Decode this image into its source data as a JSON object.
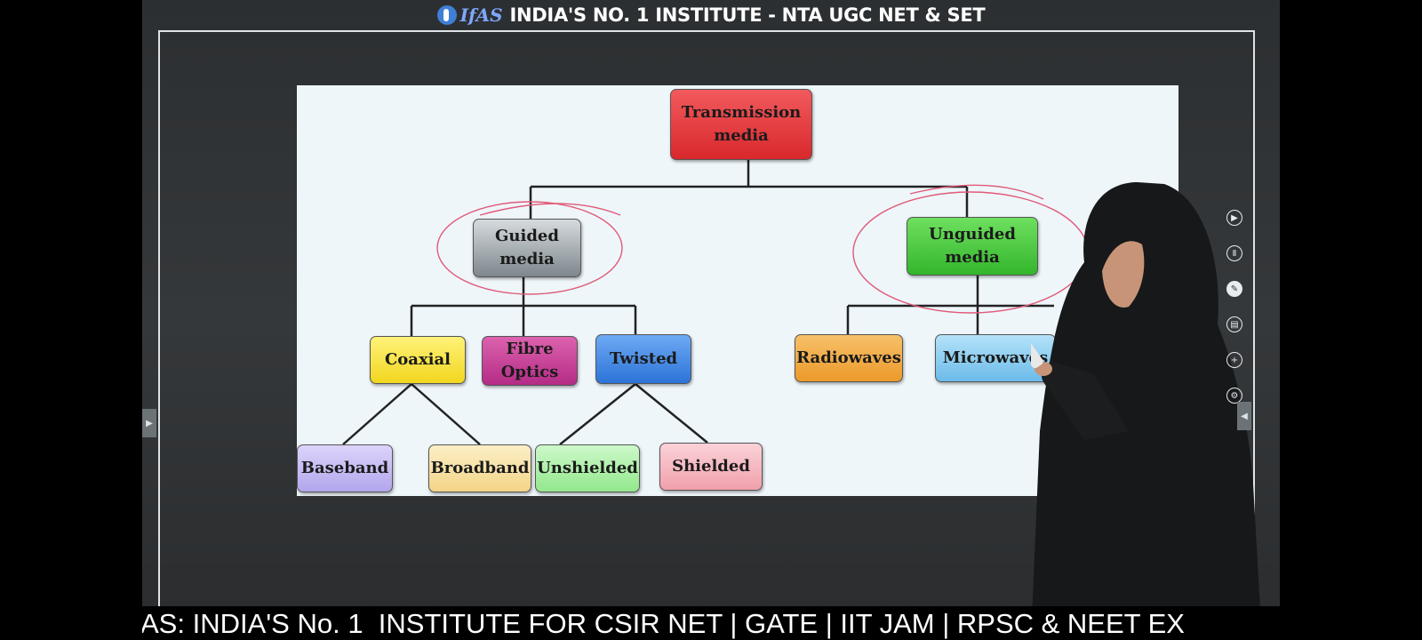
{
  "header": {
    "logo_text": "IfAS",
    "title": "INDIA'S NO. 1 INSTITUTE - NTA UGC NET & SET"
  },
  "diagram": {
    "root": "Transmission media",
    "guided": "Guided media",
    "unguided": "Unguided media",
    "coaxial": "Coaxial",
    "fibre_optics": "Fibre Optics",
    "twisted": "Twisted",
    "radiowaves": "Radiowaves",
    "microwaves": "Microwaves",
    "baseband": "Baseband",
    "broadband": "Broadband",
    "unshielded": "Unshielded",
    "shielded": "Shielded"
  },
  "colors": {
    "root": "#e0383c",
    "guided": "#9aa2a8",
    "unguided": "#47c940",
    "coaxial": "#f5e13a",
    "fibre_optics": "#c43a94",
    "twisted": "#3a86e6",
    "radiowaves": "#f0a63c",
    "microwaves": "#7fc6ee",
    "baseband": "#c2b8f2",
    "broadband": "#f7e0a2",
    "unshielded": "#a9efa4",
    "shielded": "#f5b7c0",
    "annotation": "#e05a78"
  },
  "toolbar": {
    "icons": [
      "play-icon",
      "pause-icon",
      "pen-icon",
      "layers-icon",
      "add-icon",
      "settings-icon"
    ]
  },
  "ticker": {
    "text": "AS: INDIA'S No. 1  INSTITUTE FOR CSIR NET | GATE | IIT JAM | RPSC & NEET EX"
  }
}
